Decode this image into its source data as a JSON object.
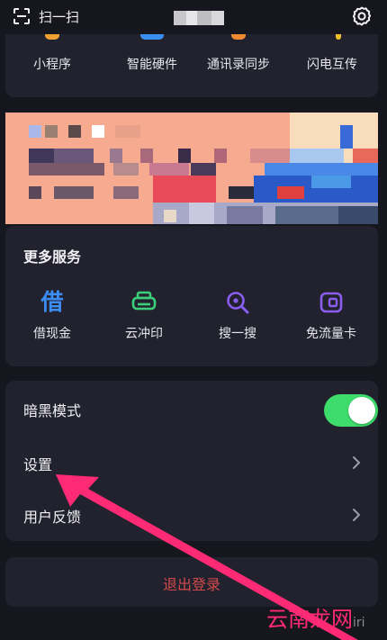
{
  "top_bar": {
    "scan_label": "扫一扫",
    "scan_icon": "scan-icon",
    "settings_icon": "gear-icon"
  },
  "apps": [
    {
      "label": "小程序",
      "accent": "#f0a030"
    },
    {
      "label": "智能硬件",
      "accent": "#3a8ef0"
    },
    {
      "label": "通讯录同步",
      "accent": "#f08a30"
    },
    {
      "label": "闪电互传",
      "accent": "#f0c030"
    }
  ],
  "services": {
    "title": "更多服务",
    "items": [
      {
        "label": "借现金",
        "icon": "借",
        "color": "#3c8ef5"
      },
      {
        "label": "云冲印",
        "icon": "printer-icon",
        "color": "#3ccf7a"
      },
      {
        "label": "搜一搜",
        "icon": "search-icon",
        "color": "#8a5cf0"
      },
      {
        "label": "免流量卡",
        "icon": "sim-card-icon",
        "color": "#8a5cf0"
      }
    ]
  },
  "list": {
    "dark_mode_label": "暗黑模式",
    "dark_mode_on": true,
    "settings_label": "设置",
    "feedback_label": "用户反馈"
  },
  "logout_label": "退出登录",
  "watermark": {
    "text": "云南龙网",
    "suffix": "iri"
  },
  "colors": {
    "background": "#16161e",
    "card": "#22222f",
    "toggle_on": "#3ddc6c",
    "logout": "#d24a4a",
    "annotation_arrow": "#ff2a74"
  }
}
